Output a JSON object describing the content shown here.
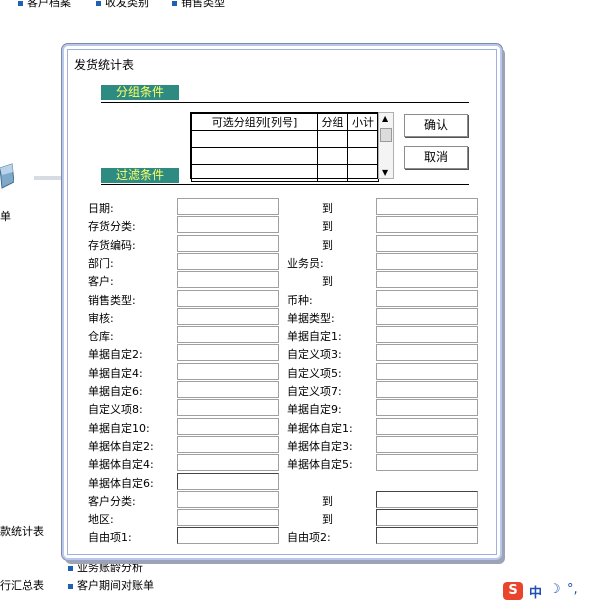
{
  "background": {
    "top_links": [
      "客户档案",
      "收发类别",
      "销售类型"
    ],
    "left_partial": "单",
    "left_mid_text": "款统计表",
    "left_bottom_text": "行汇总表",
    "bottom_links": [
      "业务账龄分析",
      "客户期间对账单"
    ]
  },
  "dialog": {
    "title": "发货统计表",
    "group_section": "分组条件",
    "filter_section": "过滤条件",
    "grid_headers": [
      "可选分组列[列号]",
      "分组",
      "小计"
    ],
    "grid_rows": 3,
    "ok_label": "确认",
    "cancel_label": "取消"
  },
  "filters": {
    "left": [
      "日期:",
      "存货分类:",
      "存货编码:",
      "部门:",
      "客户:",
      "销售类型:",
      "审核:",
      "仓库:",
      "单据自定2:",
      "单据自定4:",
      "单据自定6:",
      "自定义项8:",
      "单据自定10:",
      "单据体自定2:",
      "单据体自定4:",
      "单据体自定6:",
      "客户分类:",
      "地区:",
      "自由项1:"
    ],
    "right": [
      "到",
      "到",
      "到",
      "业务员:",
      "到",
      "币种:",
      "单据类型:",
      "单据自定1:",
      "自定义项3:",
      "自定义项5:",
      "自定义项7:",
      "单据自定9:",
      "单据体自定1:",
      "单据体自定3:",
      "单据体自定5:",
      "",
      "到",
      "到",
      "自由项2:"
    ]
  },
  "ime": {
    "logo": "S",
    "mode": "中",
    "moon": "☽",
    "punct": "°,"
  },
  "colors": {
    "section_bg": "#2e8b82",
    "section_text": "#ffff66",
    "dialog_border": "#b9c7ea"
  }
}
